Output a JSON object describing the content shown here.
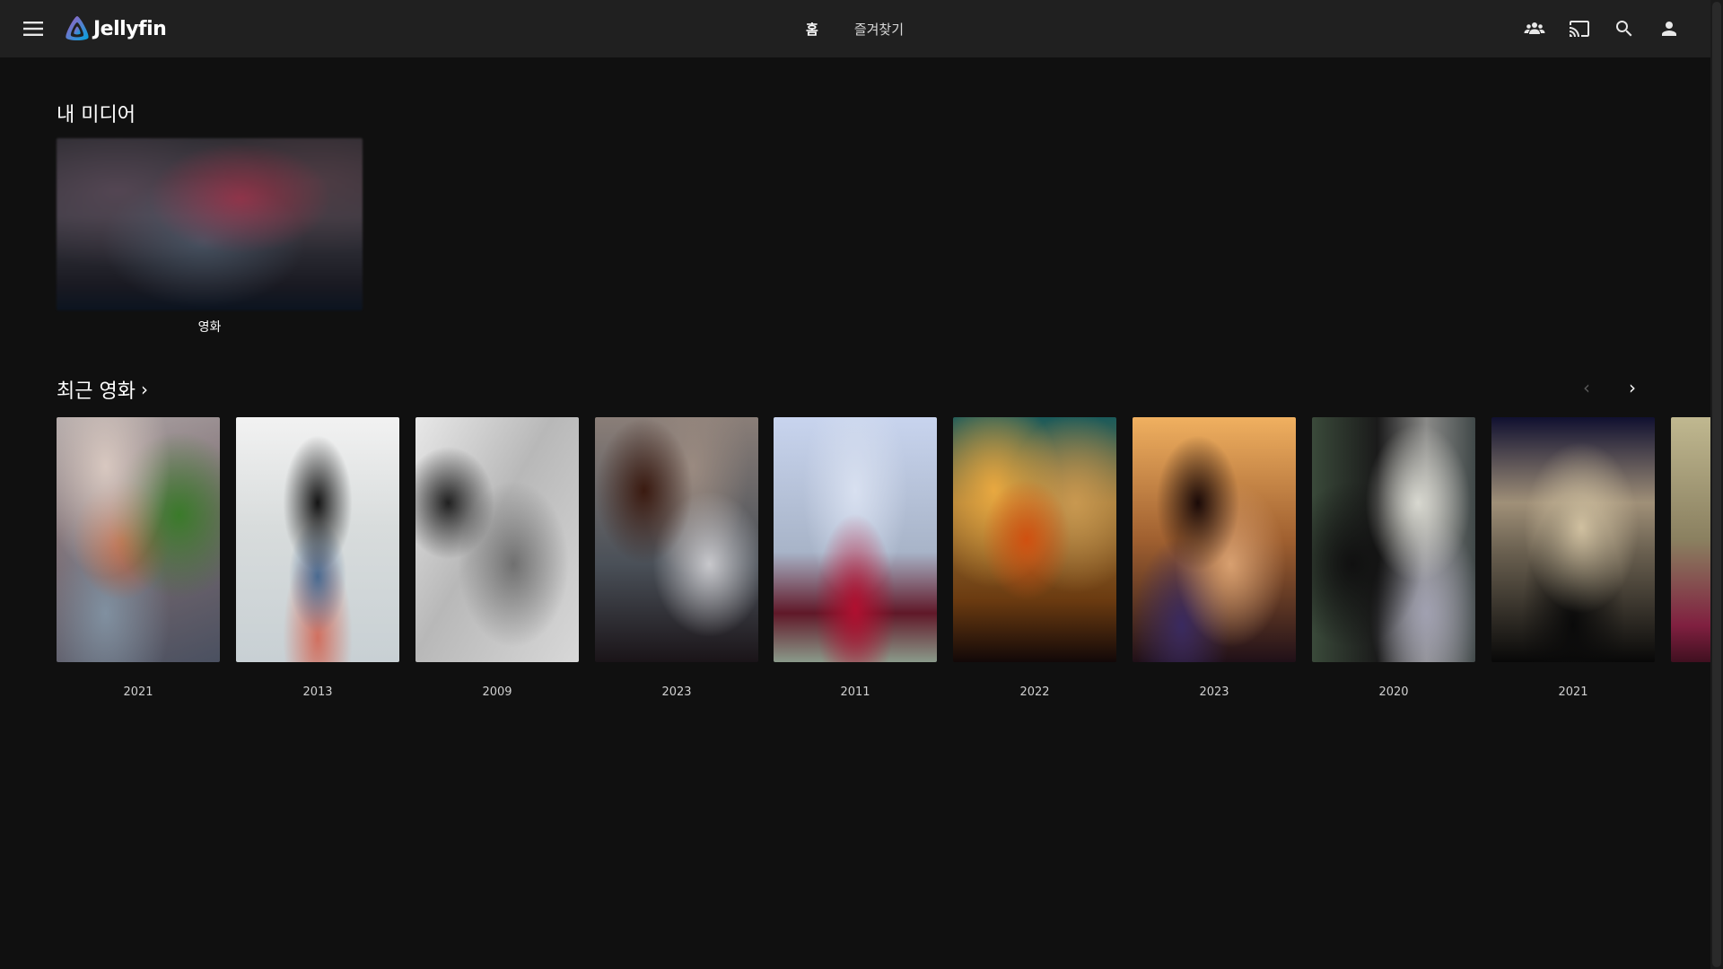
{
  "app": {
    "logo_text": "Jellyfin",
    "accent_colors": [
      "#aa5cc3",
      "#00a4dc"
    ]
  },
  "header": {
    "tabs": [
      {
        "label": "홈",
        "active": true
      },
      {
        "label": "즐겨찾기",
        "active": false
      }
    ],
    "icons": [
      "menu-icon",
      "syncplay-icon",
      "cast-icon",
      "search-icon",
      "user-icon"
    ]
  },
  "my_media": {
    "title": "내 미디어",
    "items": [
      {
        "label": "영화"
      }
    ]
  },
  "recent_movies": {
    "title": "최근 영화",
    "items": [
      {
        "year": "2021"
      },
      {
        "year": "2013"
      },
      {
        "year": "2009"
      },
      {
        "year": "2023"
      },
      {
        "year": "2011"
      },
      {
        "year": "2022"
      },
      {
        "year": "2023"
      },
      {
        "year": "2020"
      },
      {
        "year": "2021"
      },
      {
        "year": ""
      }
    ]
  }
}
